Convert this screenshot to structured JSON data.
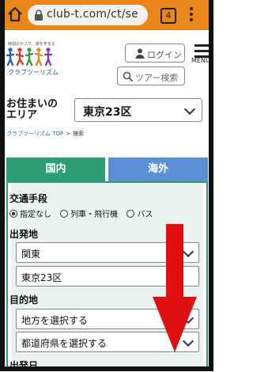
{
  "browser": {
    "url": "club-t.com/ct/se",
    "tab_count": "4",
    "bar_color": "#e8861a"
  },
  "header": {
    "logo_tagline": "時間のかぶり、旅を学まる",
    "logo_text": "クラブツーリズム",
    "login_label": "ログイン",
    "menu_label": "MENU",
    "search_label": "ツアー検索"
  },
  "area": {
    "label": "お住まいの\nエリア",
    "value": "東京23区"
  },
  "breadcrumb": {
    "home": "クラブツーリズム TOP",
    "separator": ">",
    "current": "検索"
  },
  "tabs": {
    "domestic": "国内",
    "overseas": "海外",
    "domestic_color": "#2c9e74",
    "overseas_color": "#5b8fd6"
  },
  "form": {
    "transport_label": "交通手段",
    "transport_options": [
      "指定なし",
      "列車・飛行機",
      "バス"
    ],
    "departure_label": "出発地",
    "departure_region": "関東",
    "departure_city": "東京23区",
    "destination_label": "目的地",
    "destination_region": "地方を選択する",
    "destination_prefecture": "都道府県を選択する",
    "departure_date_label": "出発日"
  },
  "overlay": {
    "arrow_color": "#e01010",
    "arrow_icon": "down-arrow"
  }
}
